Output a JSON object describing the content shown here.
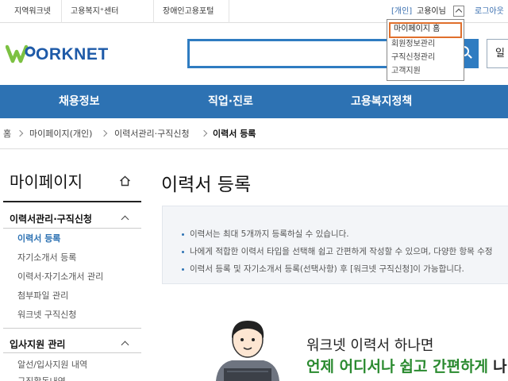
{
  "util": {
    "links": [
      "지역워크넷",
      "고용복지⁺센터",
      "장애인고용포털"
    ],
    "member_type": "[개인]",
    "user_name": "고용이님",
    "logout": "로그아웃"
  },
  "dropdown": {
    "items": [
      "마이페이지 홈",
      "회원정보관리",
      "구직신청관리",
      "고객지원"
    ]
  },
  "brand": {
    "logo_text": "ORKNET",
    "logo_initial": "W"
  },
  "search": {
    "value": "",
    "side_button": "일"
  },
  "nav": {
    "items": [
      "채용정보",
      "직업·진로",
      "고용복지정책"
    ]
  },
  "breadcrumb": [
    "홈",
    "마이페이지(개인)",
    "이력서관리·구직신청",
    "이력서 등록"
  ],
  "sidebar": {
    "title": "마이페이지",
    "sections": [
      {
        "title": "이력서관리·구직신청",
        "items": [
          "이력서 등록",
          "자기소개서 등록",
          "이력서·자기소개서 관리",
          "첨부파일 관리",
          "워크넷 구직신청"
        ]
      },
      {
        "title": "입사지원 관리",
        "items": [
          "알선/입사지원 내역",
          "구직활동내역"
        ]
      }
    ]
  },
  "main": {
    "title": "이력서 등록",
    "info": [
      "이력서는 최대 5개까지 등록하실 수 있습니다.",
      "나에게 적합한 이력서 타입을 선택해 쉽고 간편하게 작성할 수 있으며, 다양한 항목 수정",
      "이력서 등록 및 자기소개서 등록(선택사항) 후 [워크넷 구직신청]이 가능합니다."
    ],
    "promo_line1": "워크넷 이력서 하나면",
    "promo_line2_a": "언제 어디서나",
    "promo_line2_b": "쉽고 간편하게",
    "promo_line2_c": "나"
  },
  "colors": {
    "brand_blue": "#2d72b3",
    "highlight_orange": "#e06f2c",
    "promo_green": "#2a8a2f"
  }
}
